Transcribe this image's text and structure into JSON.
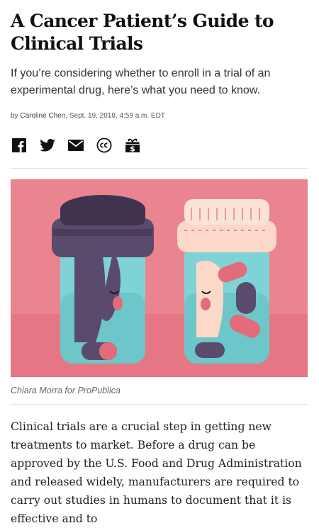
{
  "article": {
    "headline": "A Cancer Patient’s Guide to Clinical Trials",
    "dek": "If you’re considering whether to enroll in a trial of an experimental drug, here’s what you need to know.",
    "byline_prefix": "by ",
    "author": "Caroline Chen",
    "dateline": ", Sept. 19, 2018, 4:59 a.m. EDT",
    "share_icons": [
      "facebook-icon",
      "twitter-icon",
      "email-icon",
      "creative-commons-icon",
      "gift-icon"
    ],
    "image_caption": "Chiara Morra for ProPublica",
    "body_text": "Clinical trials are a crucial step in getting new treatments to market. Before a drug can be approved by the U.S. Food and Drug Administration and released widely, manufacturers are required to carry out studies in humans to document that it is effective and to"
  },
  "colors": {
    "illustration_background": "#ea848f",
    "bottle_glass": "#7fd3d6",
    "dark_cap": "#5a4a6b",
    "light_cap": "#fbd8c7"
  }
}
